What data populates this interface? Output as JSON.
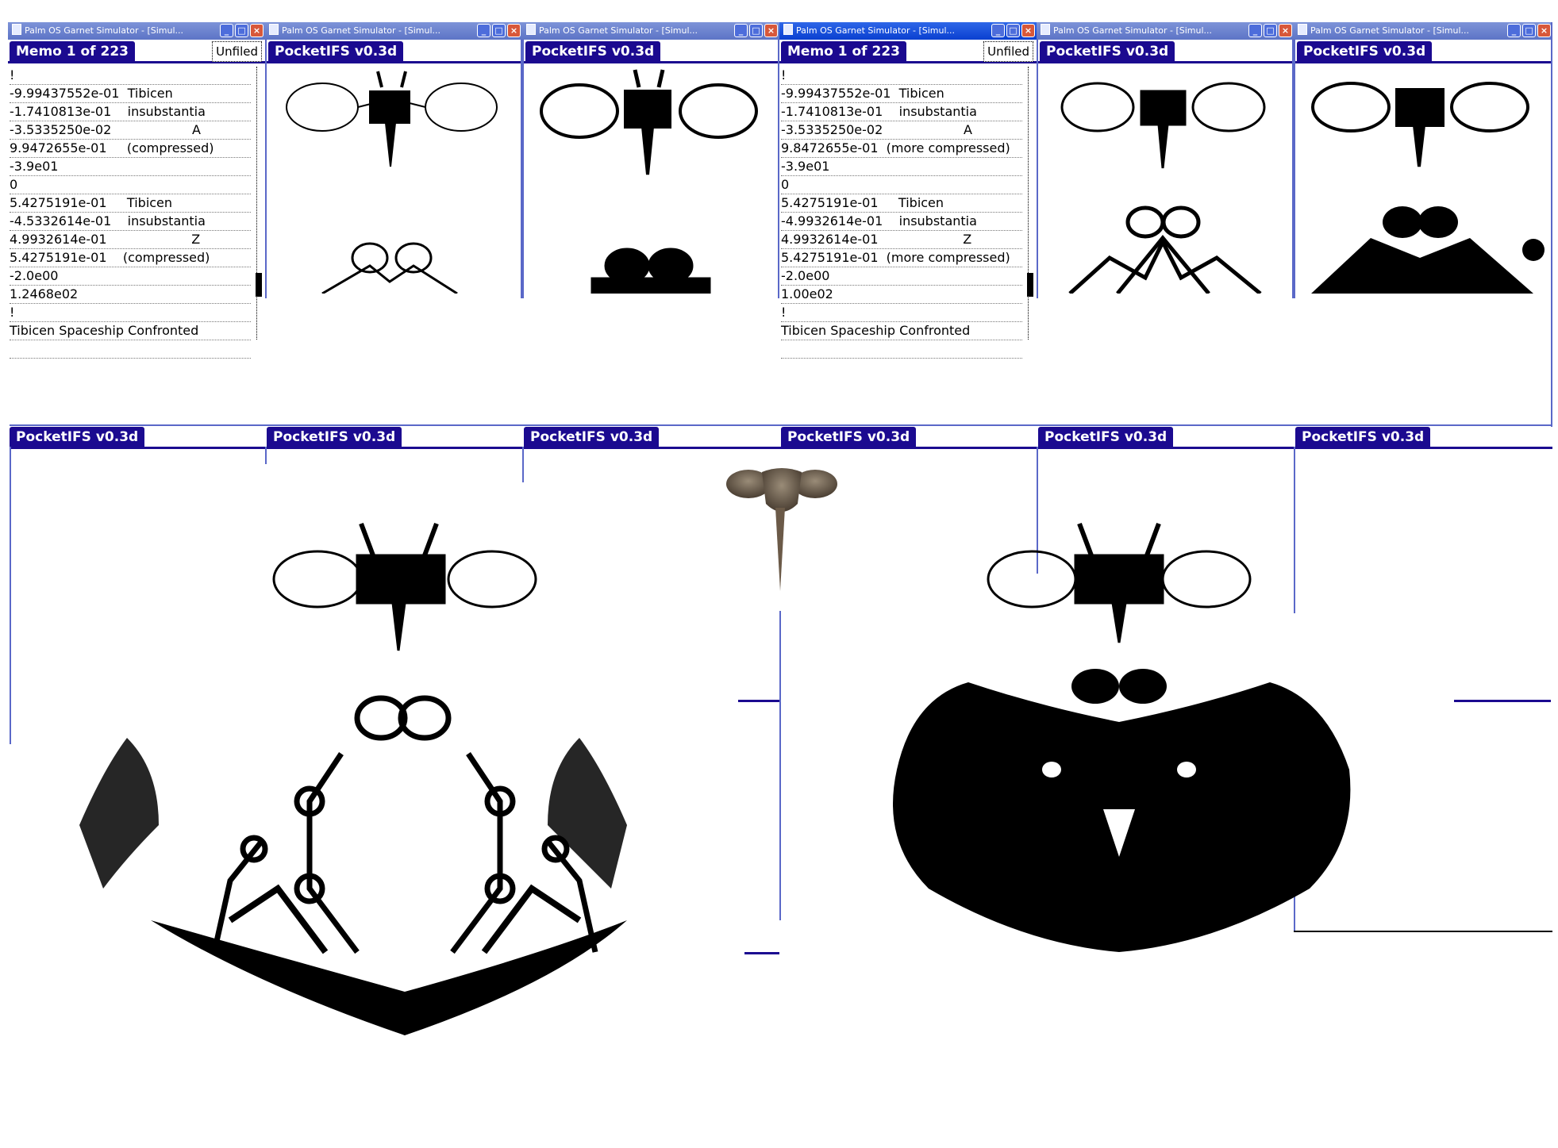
{
  "window_title": "Palm OS Garnet Simulator - [Simul...",
  "window_buttons": {
    "minimize": "_",
    "maximize": "□",
    "close": "×"
  },
  "top_row": {
    "memo1": {
      "form_title": "Memo 1 of 223",
      "category": "Unfiled",
      "lines": [
        "!",
        "-9.99437552e-01  Tibicen",
        "-1.7410813e-01    insubstantia",
        "-3.5335250e-02                    A",
        "9.9472655e-01     (compressed)",
        "-3.9e01",
        "0",
        "5.4275191e-01     Tibicen",
        "-4.5332614e-01    insubstantia",
        "4.9932614e-01                     Z",
        "5.4275191e-01    (compressed)",
        "-2.0e00",
        "1.2468e02",
        "!",
        "Tibicen Spaceship Confronted"
      ]
    },
    "memo2": {
      "form_title": "Memo 1 of 223",
      "category": "Unfiled",
      "lines": [
        "!",
        "-9.99437552e-01  Tibicen",
        "-1.7410813e-01    insubstantia",
        "-3.5335250e-02                    A",
        "9.8472655e-01  (more compressed)",
        "-3.9e01",
        "0",
        "5.4275191e-01     Tibicen",
        "-4.9932614e-01    insubstantia",
        "4.9932614e-01                     Z",
        "5.4275191e-01  (more compressed)",
        "-2.0e00",
        "1.00e02",
        "!",
        "Tibicen Spaceship Confronted"
      ]
    },
    "app_title": "PocketIFS v0.3d"
  },
  "bottom_row": {
    "app_title": "PocketIFS v0.3d"
  },
  "colors": {
    "palm_title_bg": "#1b0a90",
    "xp_title": "#5d74c6",
    "xp_title_active": "#0a3fd0",
    "close_button": "#d8583a",
    "frame": "#5a68c8"
  }
}
